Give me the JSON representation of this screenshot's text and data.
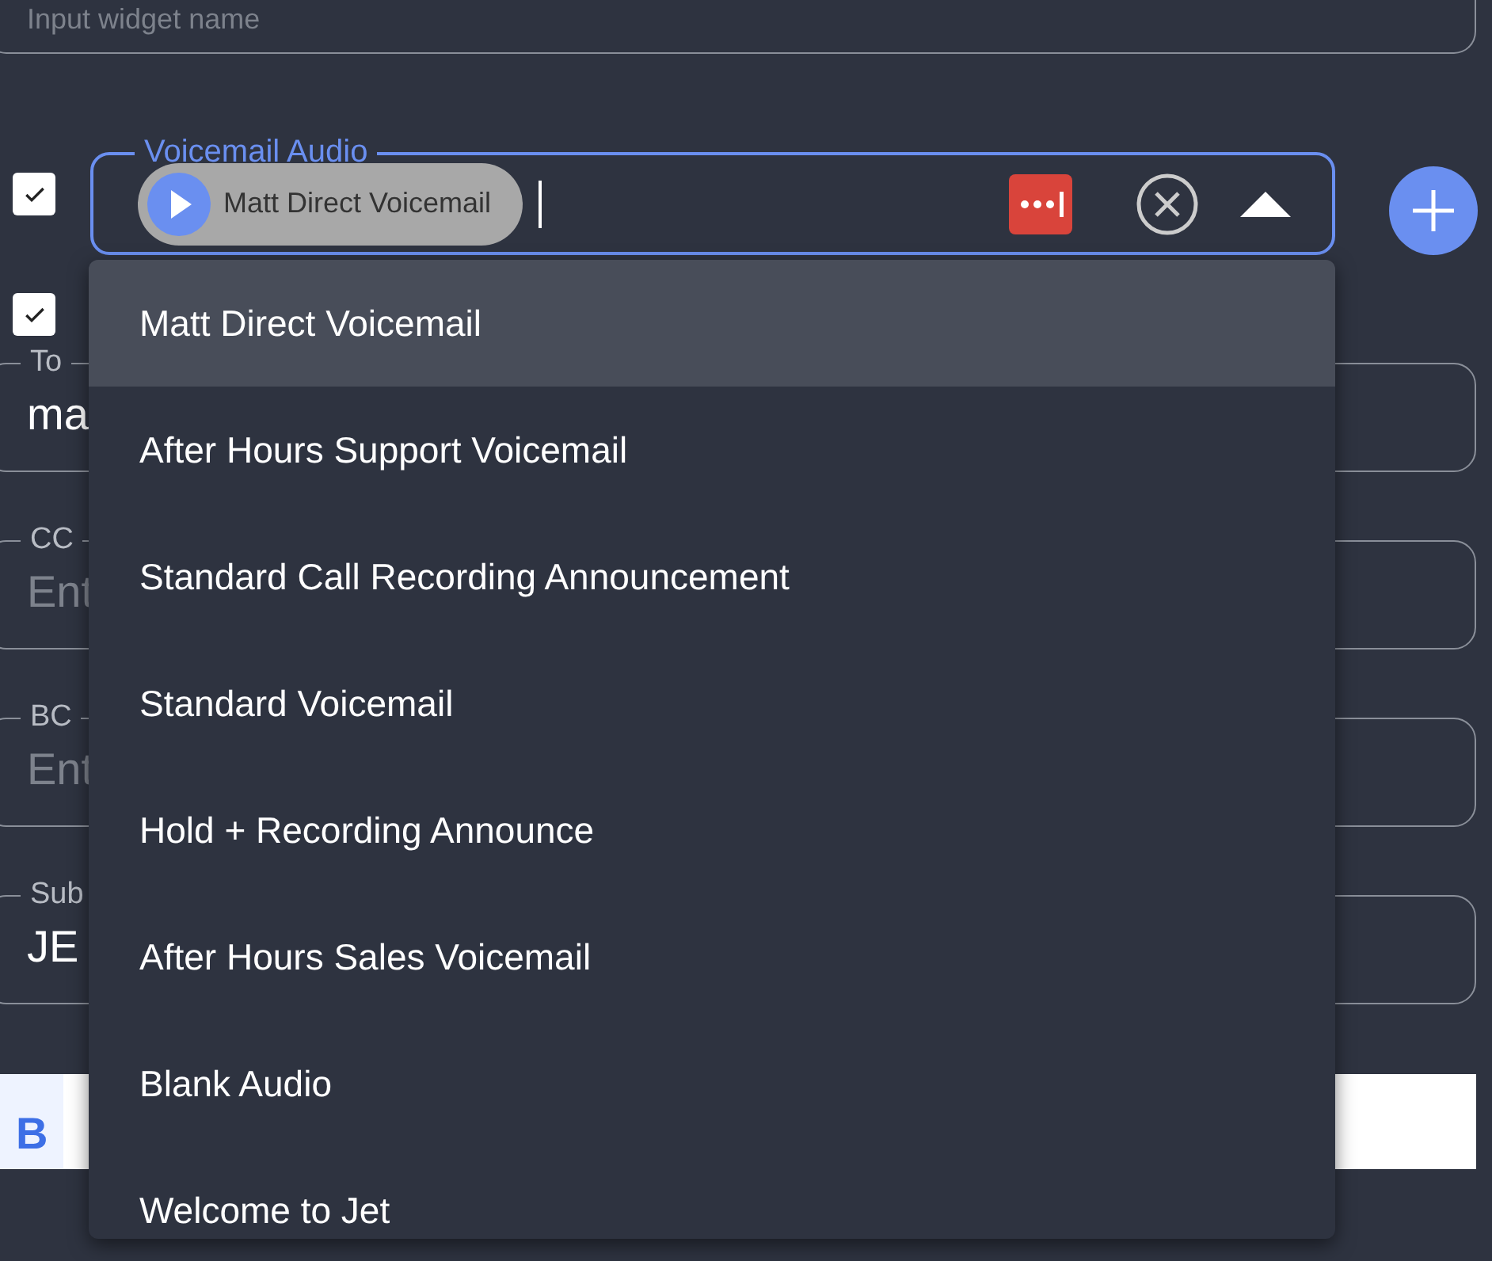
{
  "name_field": {
    "placeholder": "Input widget name"
  },
  "voicemail": {
    "checked": true,
    "label": "Voicemail Audio",
    "chip": "Matt Direct Voicemail",
    "expanded": true
  },
  "second_checkbox": {
    "checked": true
  },
  "email_fields": [
    {
      "label": "To",
      "value": "ma"
    },
    {
      "label": "CC",
      "placeholder": "Ent"
    },
    {
      "label": "BC",
      "placeholder": "Ent"
    },
    {
      "label": "Sub",
      "value": "JE"
    }
  ],
  "toolbar": [
    "B"
  ],
  "options": [
    {
      "label": "Matt Direct Voicemail",
      "selected": true
    },
    {
      "label": "After Hours Support Voicemail",
      "selected": false
    },
    {
      "label": "Standard Call Recording Announcement",
      "selected": false
    },
    {
      "label": "Standard Voicemail",
      "selected": false
    },
    {
      "label": "Hold + Recording Announce",
      "selected": false
    },
    {
      "label": "After Hours Sales Voicemail",
      "selected": false
    },
    {
      "label": "Blank Audio",
      "selected": false
    },
    {
      "label": "Welcome to Jet",
      "selected": false
    }
  ]
}
